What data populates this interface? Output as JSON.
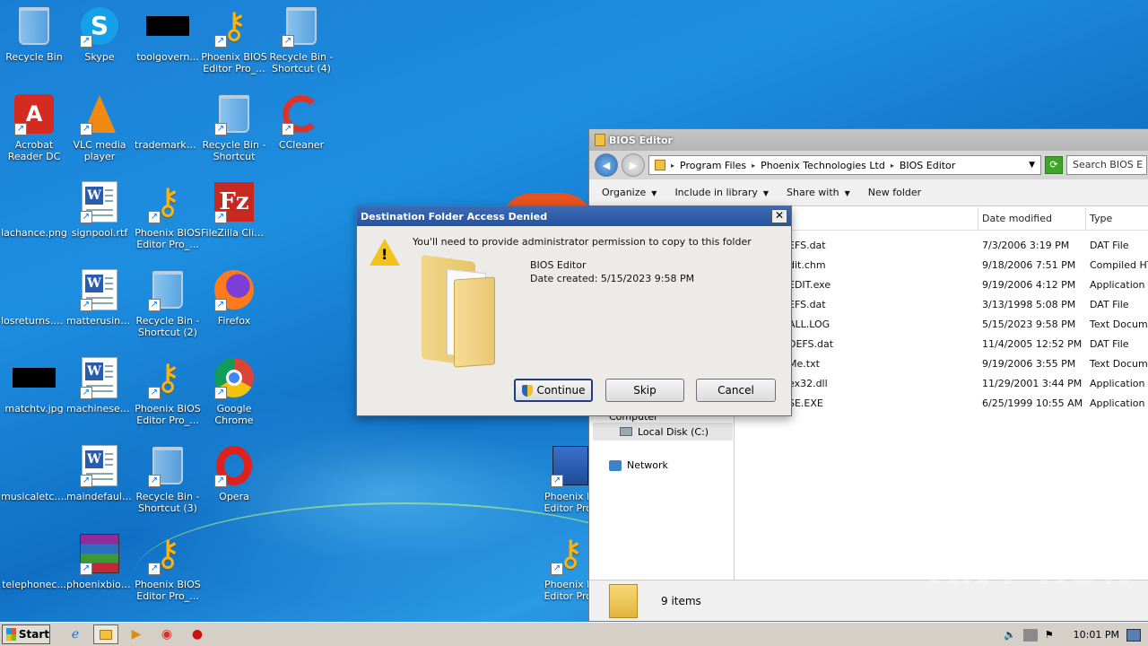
{
  "desktop": {
    "icons": [
      {
        "label": "Recycle Bin",
        "label2": "",
        "icon": "recycle-bin-icon"
      },
      {
        "label": "Skype",
        "label2": "",
        "icon": "skype-icon"
      },
      {
        "label": "toolgovern...",
        "label2": "",
        "icon": "black-image-icon"
      },
      {
        "label": "Phoenix BIOS",
        "label2": "Editor Pro_...",
        "icon": "key-icon"
      },
      {
        "label": "Recycle Bin -",
        "label2": "Shortcut (4)",
        "icon": "recycle-bin-icon"
      },
      {
        "label": "Acrobat",
        "label2": "Reader DC",
        "icon": "acrobat-icon"
      },
      {
        "label": "VLC media",
        "label2": "player",
        "icon": "vlc-icon"
      },
      {
        "label": "trademarksc...",
        "label2": "",
        "icon": "blank-file-icon"
      },
      {
        "label": "Recycle Bin -",
        "label2": "Shortcut",
        "icon": "recycle-bin-icon"
      },
      {
        "label": "CCleaner",
        "label2": "",
        "icon": "ccleaner-icon"
      },
      {
        "label": "lachance.png",
        "label2": "",
        "icon": "blank-file-icon"
      },
      {
        "label": "signpool.rtf",
        "label2": "",
        "icon": "word-doc-icon"
      },
      {
        "label": "Phoenix BIOS",
        "label2": "Editor Pro_...",
        "icon": "key-icon"
      },
      {
        "label": "FileZilla Client",
        "label2": "",
        "icon": "filezilla-icon"
      },
      {
        "label": "losreturns.png",
        "label2": "",
        "icon": "blank-file-icon"
      },
      {
        "label": "matterusing...",
        "label2": "",
        "icon": "word-doc-icon"
      },
      {
        "label": "Recycle Bin -",
        "label2": "Shortcut (2)",
        "icon": "recycle-bin-icon"
      },
      {
        "label": "Firefox",
        "label2": "",
        "icon": "firefox-icon"
      },
      {
        "label": "matchtv.jpg",
        "label2": "",
        "icon": "black-image-icon"
      },
      {
        "label": "machineset.rtf",
        "label2": "",
        "icon": "word-doc-icon"
      },
      {
        "label": "Phoenix BIOS",
        "label2": "Editor Pro_...",
        "icon": "key-icon"
      },
      {
        "label": "Google",
        "label2": "Chrome",
        "icon": "chrome-icon"
      },
      {
        "label": "musicaletc.png",
        "label2": "",
        "icon": "blank-file-icon"
      },
      {
        "label": "maindefault....",
        "label2": "",
        "icon": "word-doc-icon"
      },
      {
        "label": "Recycle Bin -",
        "label2": "Shortcut (3)",
        "icon": "recycle-bin-icon"
      },
      {
        "label": "Opera",
        "label2": "",
        "icon": "opera-icon"
      },
      {
        "label": "telephonec...",
        "label2": "",
        "icon": "blank-file-icon"
      },
      {
        "label": "phoenixbios....",
        "label2": "",
        "icon": "winrar-icon"
      },
      {
        "label": "Phoenix BIOS",
        "label2": "Editor Pro_...",
        "icon": "key-icon"
      },
      {
        "label": "Phoenix BI",
        "label2": "Editor Pro_",
        "icon": "installer-icon"
      },
      {
        "label": "Phoenix BI",
        "label2": "Editor Pro_",
        "icon": "key-icon"
      }
    ]
  },
  "explorer": {
    "title": "BIOS Editor",
    "breadcrumb": [
      "Program Files",
      "Phoenix Technologies Ltd",
      "BIOS Editor"
    ],
    "search_placeholder": "Search BIOS E",
    "commands": [
      "Organize",
      "Include in library",
      "Share with",
      "New folder"
    ],
    "columns": [
      "Date modified",
      "Type"
    ],
    "nav": {
      "computer": "Computer",
      "local_disk": "Local Disk (C:)",
      "network": "Network"
    },
    "files": [
      {
        "name": "EFS.dat",
        "date": "7/3/2006 3:19 PM",
        "type": "DAT File"
      },
      {
        "name": "dit.chm",
        "date": "9/18/2006 7:51 PM",
        "type": "Compiled HTM"
      },
      {
        "name": "EDIT.exe",
        "date": "9/19/2006 4:12 PM",
        "type": "Application"
      },
      {
        "name": "EFS.dat",
        "date": "3/13/1998 5:08 PM",
        "type": "DAT File"
      },
      {
        "name": "ALL.LOG",
        "date": "5/15/2023 9:58 PM",
        "type": "Text Documen"
      },
      {
        "name": "DEFS.dat",
        "date": "11/4/2005 12:52 PM",
        "type": "DAT File"
      },
      {
        "name": "Me.txt",
        "date": "9/19/2006 3:55 PM",
        "type": "Text Documen"
      },
      {
        "name": "ex32.dll",
        "date": "11/29/2001 3:44 PM",
        "type": "Application ex"
      },
      {
        "name": "SE.EXE",
        "date": "6/25/1999 10:55 AM",
        "type": "Application"
      }
    ],
    "status": "9 items"
  },
  "dialog": {
    "title": "Destination Folder Access Denied",
    "close": "✕",
    "message": "You'll need to provide administrator permission to copy to this folder",
    "folder_name": "BIOS Editor",
    "date_created": "Date created: 5/15/2023 9:58 PM",
    "continue": "Continue",
    "skip": "Skip",
    "cancel": "Cancel"
  },
  "watermark": "ANY RUN",
  "taskbar": {
    "start": "Start",
    "clock": "10:01 PM"
  }
}
